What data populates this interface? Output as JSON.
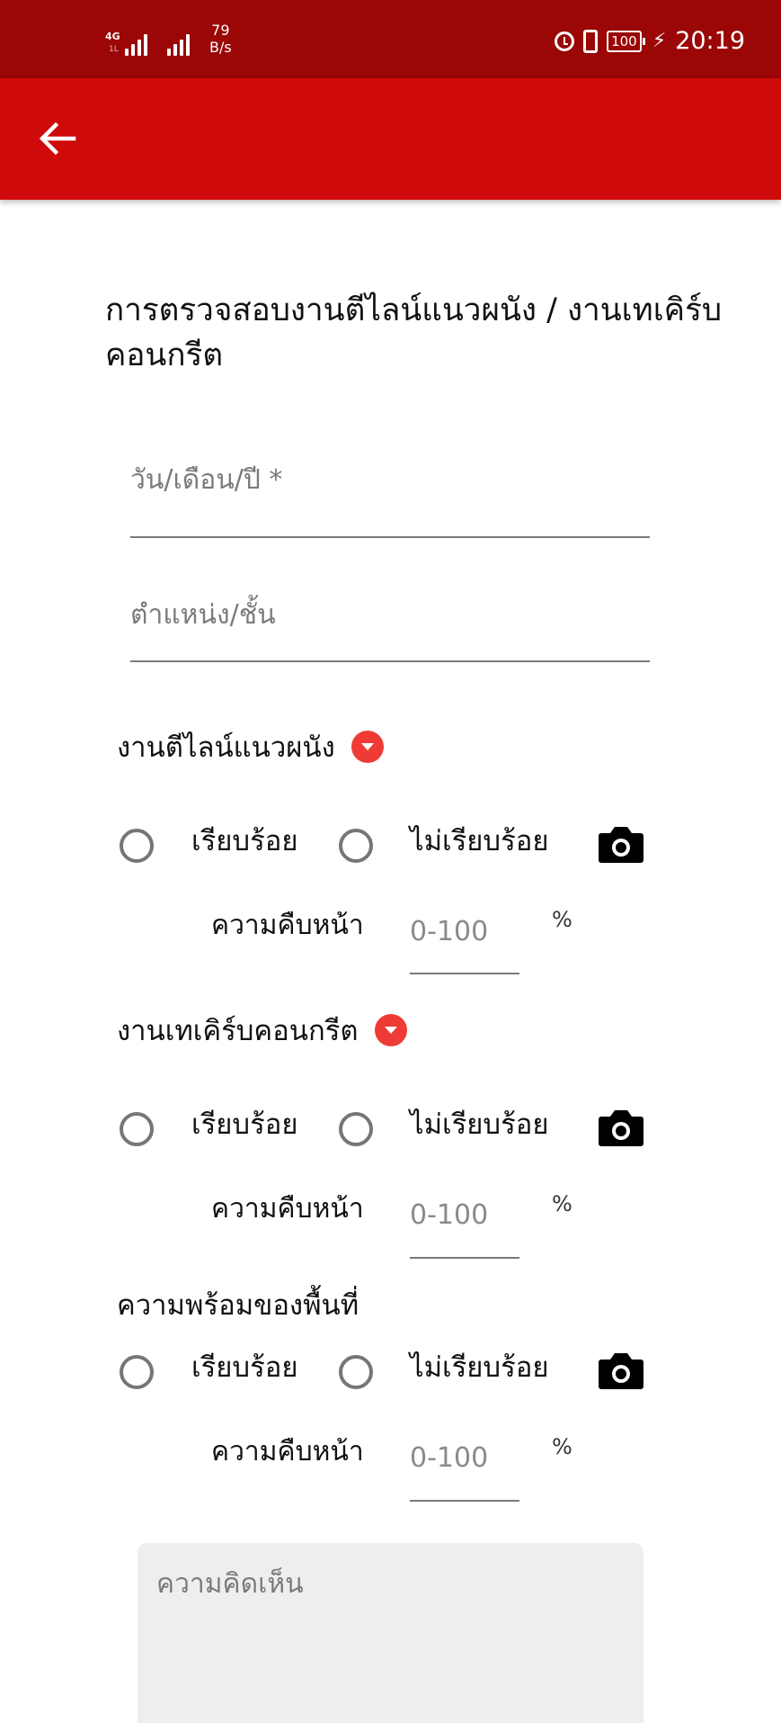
{
  "status_bar": {
    "network": "4G",
    "network_sub": "1L",
    "speed_value": "79",
    "speed_unit": "B/s",
    "battery": "100",
    "time": "20:19",
    "icons": [
      "signal-icon",
      "alarm-icon",
      "vibrate-icon",
      "battery-icon",
      "charging-icon"
    ]
  },
  "app_bar": {
    "back_icon": "arrow-left-icon",
    "background": "#cf0a0a",
    "status_background": "#9b0606"
  },
  "form": {
    "title": "การตรวจสอบงานตีไลน์แนวผนัง / งานเทเคิร์บคอนกรีต",
    "date_placeholder": "วัน/เดือน/ปี *",
    "location_placeholder": "ตำแหน่ง/ชั้น",
    "comment_placeholder": "ความคิดเห็น",
    "sections": [
      {
        "title": "งานตีไลน์แนวผนัง",
        "has_dropdown": true,
        "option_ok": "เรียบร้อย",
        "option_not_ok": "ไม่เรียบร้อย",
        "progress_label": "ความคืบหน้า",
        "progress_placeholder": "0-100",
        "progress_unit": "%"
      },
      {
        "title": "งานเทเคิร์บคอนกรีต",
        "has_dropdown": true,
        "option_ok": "เรียบร้อย",
        "option_not_ok": "ไม่เรียบร้อย",
        "progress_label": "ความคืบหน้า",
        "progress_placeholder": "0-100",
        "progress_unit": "%"
      },
      {
        "title": "ความพร้อมของพื้นที่",
        "has_dropdown": false,
        "option_ok": "เรียบร้อย",
        "option_not_ok": "ไม่เรียบร้อย",
        "progress_label": "ความคืบหน้า",
        "progress_placeholder": "0-100",
        "progress_unit": "%"
      }
    ],
    "accent_color": "#ef3b36"
  }
}
